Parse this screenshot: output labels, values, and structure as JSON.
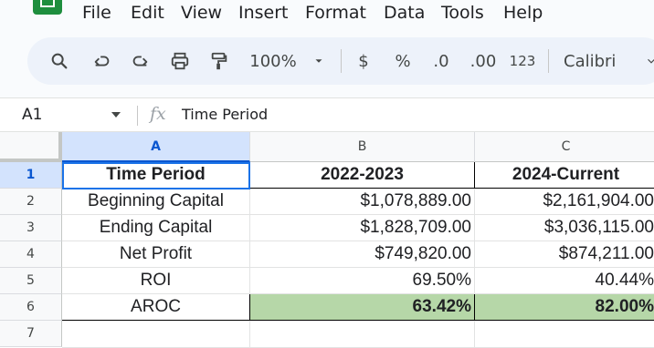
{
  "menu": [
    "File",
    "Edit",
    "View",
    "Insert",
    "Format",
    "Data",
    "Tools",
    "Help"
  ],
  "toolbar": {
    "zoom": "100%",
    "currency": "$",
    "percent": "%",
    "decrease_decimal": ".0",
    "increase_decimal": ".00",
    "number_format": "123",
    "font": "Calibri"
  },
  "formula_bar": {
    "cell_ref": "A1",
    "fx": "fx",
    "content": "Time Period"
  },
  "columns": [
    "A",
    "B",
    "C"
  ],
  "rows": [
    "1",
    "2",
    "3",
    "4",
    "5",
    "6",
    "7"
  ],
  "cells": [
    [
      "Time Period",
      "2022-2023",
      "2024-Current"
    ],
    [
      "Beginning Capital",
      "$1,078,889.00",
      "$2,161,904.00"
    ],
    [
      "Ending Capital",
      "$1,828,709.00",
      "$3,036,115.00"
    ],
    [
      "Net Profit",
      "$749,820.00",
      "$874,211.00"
    ],
    [
      "ROI",
      "69.50%",
      "40.44%"
    ],
    [
      "AROC",
      "63.42%",
      "82.00%"
    ],
    [
      "",
      "",
      ""
    ]
  ],
  "colors": {
    "highlight_green": "#b6d7a8",
    "selection_blue": "#1a73e8",
    "sheets_green": "#1e8e3e"
  }
}
